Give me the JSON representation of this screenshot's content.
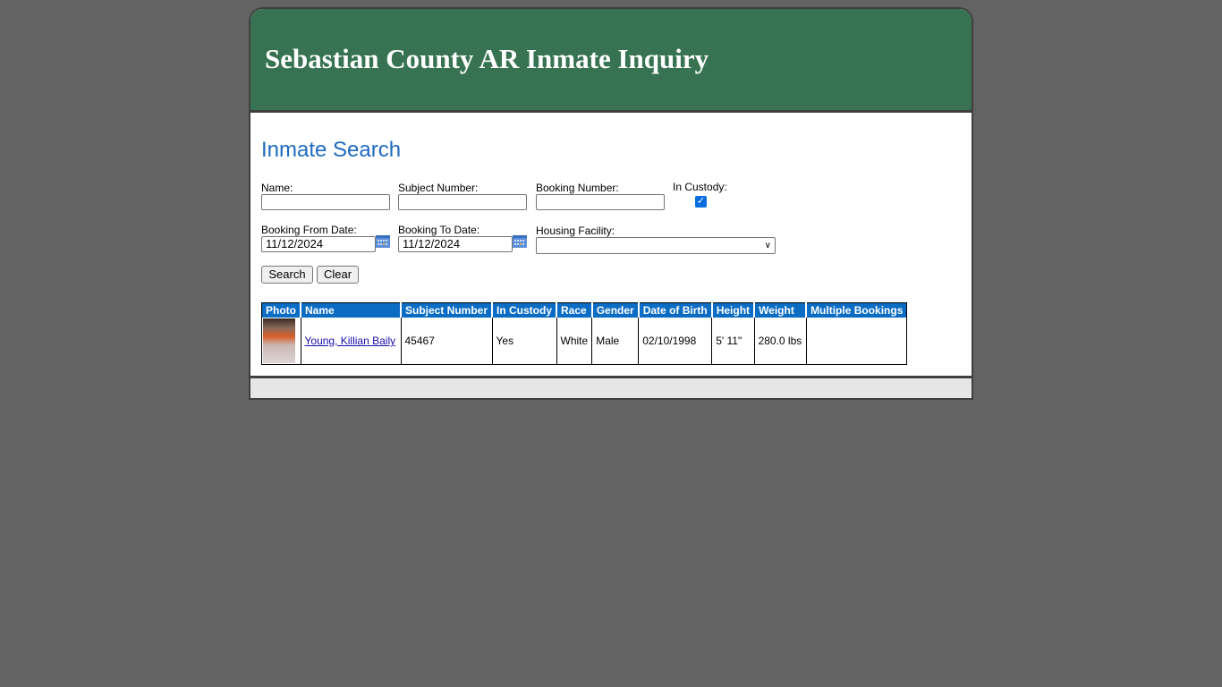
{
  "header": {
    "title": "Sebastian County AR Inmate Inquiry"
  },
  "search": {
    "title": "Inmate Search",
    "name_label": "Name:",
    "name_value": "",
    "subject_label": "Subject Number:",
    "subject_value": "",
    "booking_label": "Booking Number:",
    "booking_value": "",
    "custody_label": "In Custody:",
    "custody_checked": true,
    "from_label": "Booking From Date:",
    "from_value": "11/12/2024",
    "to_label": "Booking To Date:",
    "to_value": "11/12/2024",
    "facility_label": "Housing Facility:",
    "facility_value": "",
    "search_button": "Search",
    "clear_button": "Clear"
  },
  "results": {
    "columns": [
      "Photo",
      "Name",
      "Subject Number",
      "In Custody",
      "Race",
      "Gender",
      "Date of Birth",
      "Height",
      "Weight",
      "Multiple Bookings"
    ],
    "rows": [
      {
        "name": "Young, Killian Baily",
        "subject_number": "45467",
        "in_custody": "Yes",
        "race": "White",
        "gender": "Male",
        "dob": "02/10/1998",
        "height": "5' 11\"",
        "weight": "280.0 lbs",
        "multiple_bookings": ""
      }
    ]
  },
  "colors": {
    "header_green": "#377352",
    "accent_blue": "#0b6cc4",
    "title_blue": "#1f6bbf"
  }
}
